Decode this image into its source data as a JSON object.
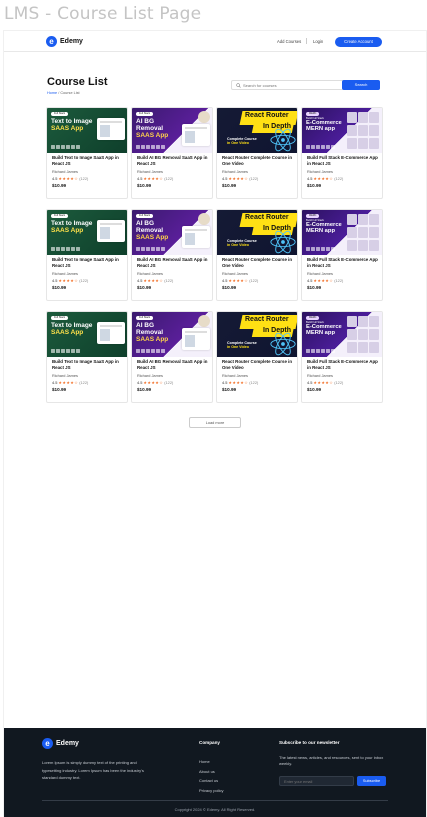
{
  "page_label": "LMS - Course List Page",
  "nav": {
    "logo_text": "Edemy",
    "add_courses": "Add Courses",
    "login": "Login",
    "create_account": "Create Account"
  },
  "header": {
    "title": "Course List",
    "breadcrumb_home": "Home",
    "breadcrumb_current": "/ Course List",
    "search_placeholder": "Search for courses",
    "search_button": "Search"
  },
  "thumbnails": {
    "text_to_image": {
      "pill": "Full Stack",
      "line1": "Text to Image",
      "line2": "SAAS App"
    },
    "bg_removal": {
      "pill": "Full Stack",
      "line1": "AI BG Removal",
      "line2": "SAAS App"
    },
    "react_router": {
      "ribbon1": "React Router",
      "ribbon2": "In Depth",
      "sub1": "Complete Course",
      "sub2": "in One Video"
    },
    "ecommerce": {
      "pill": "MERN",
      "tiny": "Build Full Stack",
      "line1": "E-Commerce",
      "line2": "MERN app"
    }
  },
  "courses": [
    {
      "title": "Build Text to Image SaaS App in React JS",
      "author": "Richard James",
      "rating": "4.5",
      "stars": "★★★★☆",
      "count": "(122)",
      "price": "$10.99"
    },
    {
      "title": "Build AI BG Removal SaaS App in React JS",
      "author": "Richard James",
      "rating": "4.5",
      "stars": "★★★★☆",
      "count": "(122)",
      "price": "$10.99"
    },
    {
      "title": "React Router Complete Course in One Video",
      "author": "Richard James",
      "rating": "4.5",
      "stars": "★★★★☆",
      "count": "(122)",
      "price": "$10.99"
    },
    {
      "title": "Build Full Stack E-Commerce App in React JS",
      "author": "Richard James",
      "rating": "4.5",
      "stars": "★★★★☆",
      "count": "(122)",
      "price": "$10.99"
    }
  ],
  "load_more": "Load more",
  "footer": {
    "logo_text": "Edemy",
    "about": "Lorem Ipsum is simply dummy text of the printing and typesetting industry. Lorem Ipsum has been the industry's standard dummy text.",
    "company_title": "Company",
    "links": [
      "Home",
      "About us",
      "Contact us",
      "Privacy policy"
    ],
    "newsletter_title": "Subscribe to our newsletter",
    "newsletter_text": "The latest news, articles, and resources, sent to your inbox weekly.",
    "email_placeholder": "Enter your email",
    "subscribe_button": "Subscribe",
    "copyright": "Copyright 2024 © Edemy. All Right Reserved."
  },
  "colors": {
    "brand": "#1a5cf0",
    "footer_bg": "#111820",
    "star": "#f26b21"
  }
}
